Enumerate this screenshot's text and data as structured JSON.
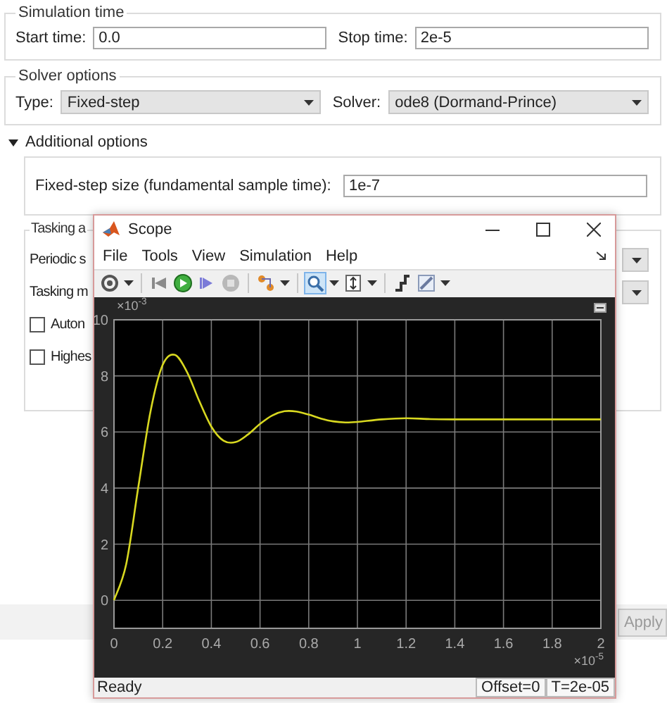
{
  "simulation_time": {
    "title": "Simulation time",
    "start_label": "Start time:",
    "start_value": "0.0",
    "stop_label": "Stop time:",
    "stop_value": "2e-5"
  },
  "solver_options": {
    "title": "Solver options",
    "type_label": "Type:",
    "type_value": "Fixed-step",
    "solver_label": "Solver:",
    "solver_value": "ode8 (Dormand-Prince)"
  },
  "additional_options": {
    "label": "Additional options",
    "expanded": true,
    "step_label": "Fixed-step size (fundamental sample time):",
    "step_value": "1e-7"
  },
  "tasking": {
    "title": "Tasking a",
    "rows": [
      {
        "kind": "dropdown",
        "label": "Periodic s"
      },
      {
        "kind": "dropdown",
        "label": "Tasking m"
      },
      {
        "kind": "checkbox",
        "label": "Auton",
        "checked": false
      },
      {
        "kind": "checkbox",
        "label": "Highes",
        "checked": false
      }
    ]
  },
  "apply_button": {
    "label": "Apply",
    "disabled": true
  },
  "scope": {
    "title": "Scope",
    "menu": [
      "File",
      "Tools",
      "View",
      "Simulation",
      "Help"
    ],
    "zoom_tool_active": true,
    "y_exponent": "×10$^{-3}$",
    "x_exponent": "×10$^{-5}$",
    "chart_data": {
      "type": "line",
      "x": [
        0,
        0.05,
        0.1,
        0.15,
        0.2,
        0.25,
        0.3,
        0.35,
        0.4,
        0.45,
        0.5,
        0.55,
        0.6,
        0.65,
        0.7,
        0.75,
        0.8,
        0.85,
        0.9,
        0.95,
        1.0,
        1.1,
        1.2,
        1.3,
        1.4,
        1.5,
        1.6,
        1.7,
        1.8,
        1.9,
        2.0
      ],
      "series": [
        {
          "color": "#d8d820",
          "values": [
            0,
            1.28,
            4.04,
            6.73,
            8.39,
            8.75,
            8.14,
            7.11,
            6.19,
            5.69,
            5.64,
            5.91,
            6.29,
            6.59,
            6.74,
            6.73,
            6.62,
            6.48,
            6.38,
            6.34,
            6.36,
            6.45,
            6.49,
            6.46,
            6.45,
            6.45,
            6.45,
            6.45,
            6.45,
            6.45,
            6.45
          ]
        }
      ],
      "xlim": [
        -0.0,
        2
      ],
      "ylim": [
        -1,
        10
      ],
      "xticks": [
        0,
        0.2,
        0.4,
        0.6,
        0.8,
        1,
        1.2,
        1.4,
        1.6,
        1.8,
        2
      ],
      "yticks": [
        0,
        2,
        4,
        6,
        8,
        10
      ],
      "grid": true
    },
    "status": "Ready",
    "offset": "Offset=0",
    "time": "T=2e-05"
  }
}
